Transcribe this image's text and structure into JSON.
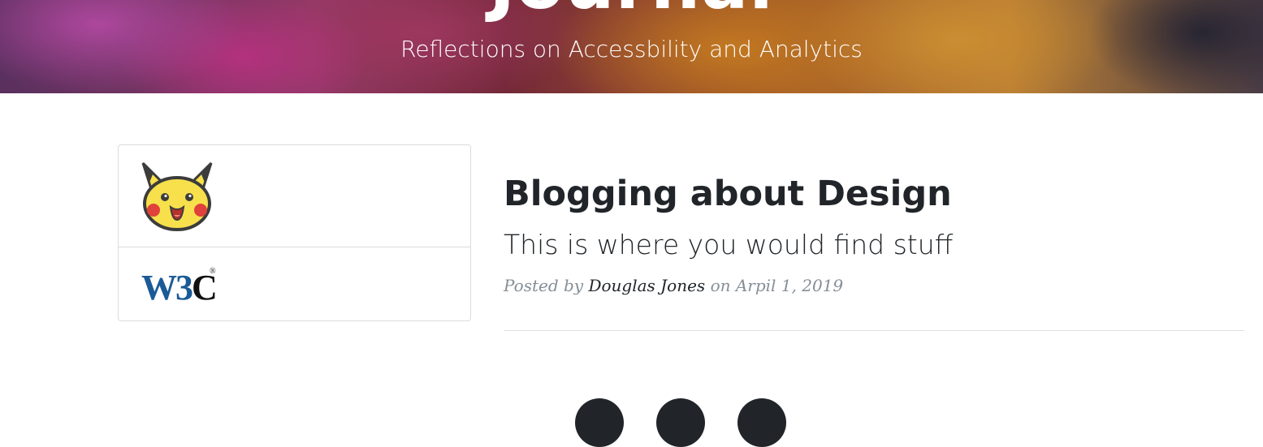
{
  "masthead": {
    "title": "Journal",
    "subtitle": "Reflections on Accessbility and Analytics"
  },
  "sidebar_card": {
    "logos": [
      {
        "icon": "pikachu-icon"
      },
      {
        "icon": "w3c-logo",
        "text": "W3C"
      }
    ]
  },
  "post": {
    "title": "Blogging about Design",
    "subtitle": "This is where you would find stuff",
    "meta_prefix": "Posted by",
    "author": "Douglas Jones",
    "meta_on": "on Arpil 1, 2019"
  },
  "footer": {
    "social_icons": [
      "social-icon-1",
      "social-icon-2",
      "social-icon-3"
    ]
  },
  "colors": {
    "text": "#212529",
    "muted": "#868e96",
    "w3c_blue": "#1a5a96"
  }
}
